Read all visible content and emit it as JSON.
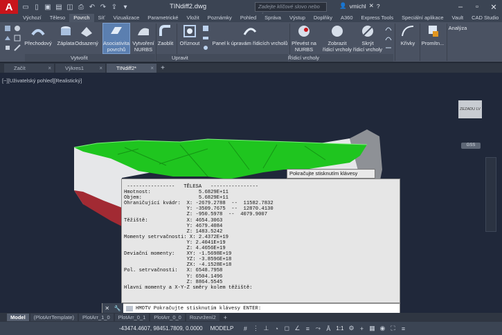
{
  "titlebar": {
    "logo": "A",
    "doc_title": "TINdiff2.dwg",
    "search_placeholder": "Zadejte klíčové slovo nebo výraz",
    "user": "vmichl",
    "help": "?"
  },
  "ribbon_tabs": [
    "Výchozí",
    "Těleso",
    "Povrch",
    "Síť",
    "Vizualizace",
    "Parametrické",
    "Vložit",
    "Poznámky",
    "Pohled",
    "Správa",
    "Výstup",
    "Doplňky",
    "A360",
    "Express Tools",
    "Speciální aplikace",
    "Vault",
    "CAD Studio"
  ],
  "ribbon_active_tab_index": 2,
  "ribbon": {
    "prechodovy": "Přechodový",
    "zaplata": "Záplata",
    "odsazeny": "Odsazený",
    "asociativita": [
      "Asociativita",
      "povrchů"
    ],
    "vytvoreni_nurbs": [
      "Vytvoření",
      "NURBS"
    ],
    "zaoblit": "Zaoblit",
    "oriznout": "Oříznout",
    "panel_rizeni": "Panel k úpravám řídicích vrcholů",
    "prevest_na_nurbs": [
      "Převést na",
      "NURBS"
    ],
    "zobrazit_vrcholy": [
      "Zobrazit",
      "řídicí vrcholy"
    ],
    "skryt_vrcholy": [
      "Skrýt",
      "řídicí vrcholy"
    ],
    "krivky": "Křivky",
    "promitn": "Promítn...",
    "analyza": "Analýza",
    "group_vytvorit": "Vytvořit",
    "group_upravit": "Upravit",
    "group_ridici": "Řídicí vrcholy"
  },
  "file_tabs": [
    {
      "label": "Začít",
      "active": false
    },
    {
      "label": "Výkres1",
      "active": false
    },
    {
      "label": "TINdiff2*",
      "active": true
    }
  ],
  "viewport": {
    "label": "[−][Uživatelský pohled][Realistický]",
    "viewcube_face": "ZEZADU",
    "viewcube_side": "LV",
    "wcs": "GSS"
  },
  "tooltip": "Pokračujte stisknutím klávesy ENTER:",
  "text_window_lines": [
    " ----------------   TĚLESA   ----------------",
    "Hmotnost:                5.6829E+11",
    "Objem:                   5.6829E+11",
    "Ohraničující kvádr:  X: -2679.2788  --  11582.7832",
    "                     Y: -3509.7675  --  12870.4130",
    "                     Z: -950.5978  --  4079.9007",
    "Těžiště:             X: 4654.3063",
    "                     Y: 4679.4084",
    "                     Z: 1483.5242",
    "Momenty setrvačnosti: X: 2.4372E+19",
    "                     Y: 2.4041E+19",
    "                     Z: 4.4656E+19",
    "Deviační momenty:    XY: -1.5698E+19",
    "                     YZ: -3.8596E+18",
    "                     ZX: -4.1528E+18",
    "Pol. setrvačnosti:   X: 6548.7958",
    "                     Y: 6504.1496",
    "                     Z: 8864.5545",
    "Hlavní momenty a X-Y-Z směry kolem těžiště:"
  ],
  "command_line": {
    "text": "HMOTV Pokračujte stisknutím klávesy ENTER:"
  },
  "layout_tabs": [
    {
      "label": "Model",
      "active": true
    },
    {
      "label": "(PlotArrTemplate)",
      "active": false
    },
    {
      "label": "PlotArr_1_0",
      "active": false
    },
    {
      "label": "PlotArr_0_1",
      "active": false
    },
    {
      "label": "PlotArr_0_0",
      "active": false
    },
    {
      "label": "Rozvržení2",
      "active": false
    }
  ],
  "statusbar": {
    "coords": "-43474.4607, 98451.7809, 0.0000",
    "space": "MODELP",
    "scale": "1:1"
  },
  "colors": {
    "accent_red": "#c8151b",
    "surface_green": "#1fc51f",
    "ribbon_bg": "#4a5262",
    "viewport_bg": "#20283a"
  }
}
